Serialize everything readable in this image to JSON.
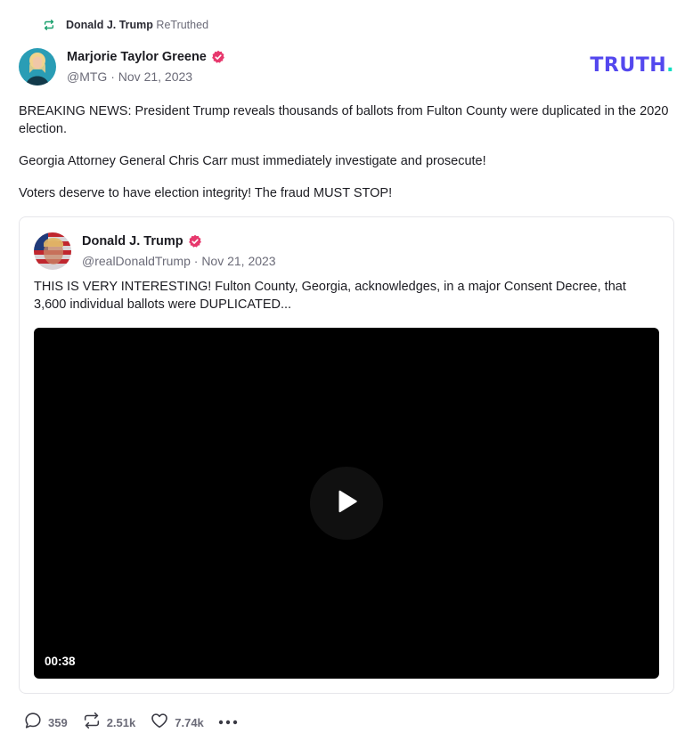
{
  "retruth": {
    "icon": "retruth-icon",
    "name": "Donald J. Trump",
    "action": "ReTruthed"
  },
  "post": {
    "author": {
      "name": "Marjorie Taylor Greene",
      "handle": "@MTG",
      "date": "Nov 21, 2023",
      "verified": true
    },
    "paragraphs": [
      "BREAKING NEWS: President Trump reveals thousands of ballots from Fulton County were duplicated in the 2020 election.",
      "Georgia Attorney General Chris Carr must immediately investigate and prosecute!",
      "Voters deserve to have election integrity! The fraud MUST STOP!"
    ]
  },
  "logo": {
    "main": "TRUTH",
    "dot": "."
  },
  "quote": {
    "author": {
      "name": "Donald J. Trump",
      "handle": "@realDonaldTrump",
      "date": "Nov 21, 2023",
      "verified": true
    },
    "text": "THIS IS VERY INTERESTING! Fulton County, Georgia, acknowledges, in a major Consent Decree, that 3,600 individual ballots were DUPLICATED...",
    "video": {
      "duration": "00:38"
    }
  },
  "actions": {
    "replies": "359",
    "retruths": "2.51k",
    "likes": "7.74k"
  },
  "colors": {
    "brand": "#5448ee",
    "brand_accent": "#0bdec2",
    "verified": "#e7386d",
    "retruth_icon": "#1aa06d",
    "muted": "#6b6b78"
  }
}
